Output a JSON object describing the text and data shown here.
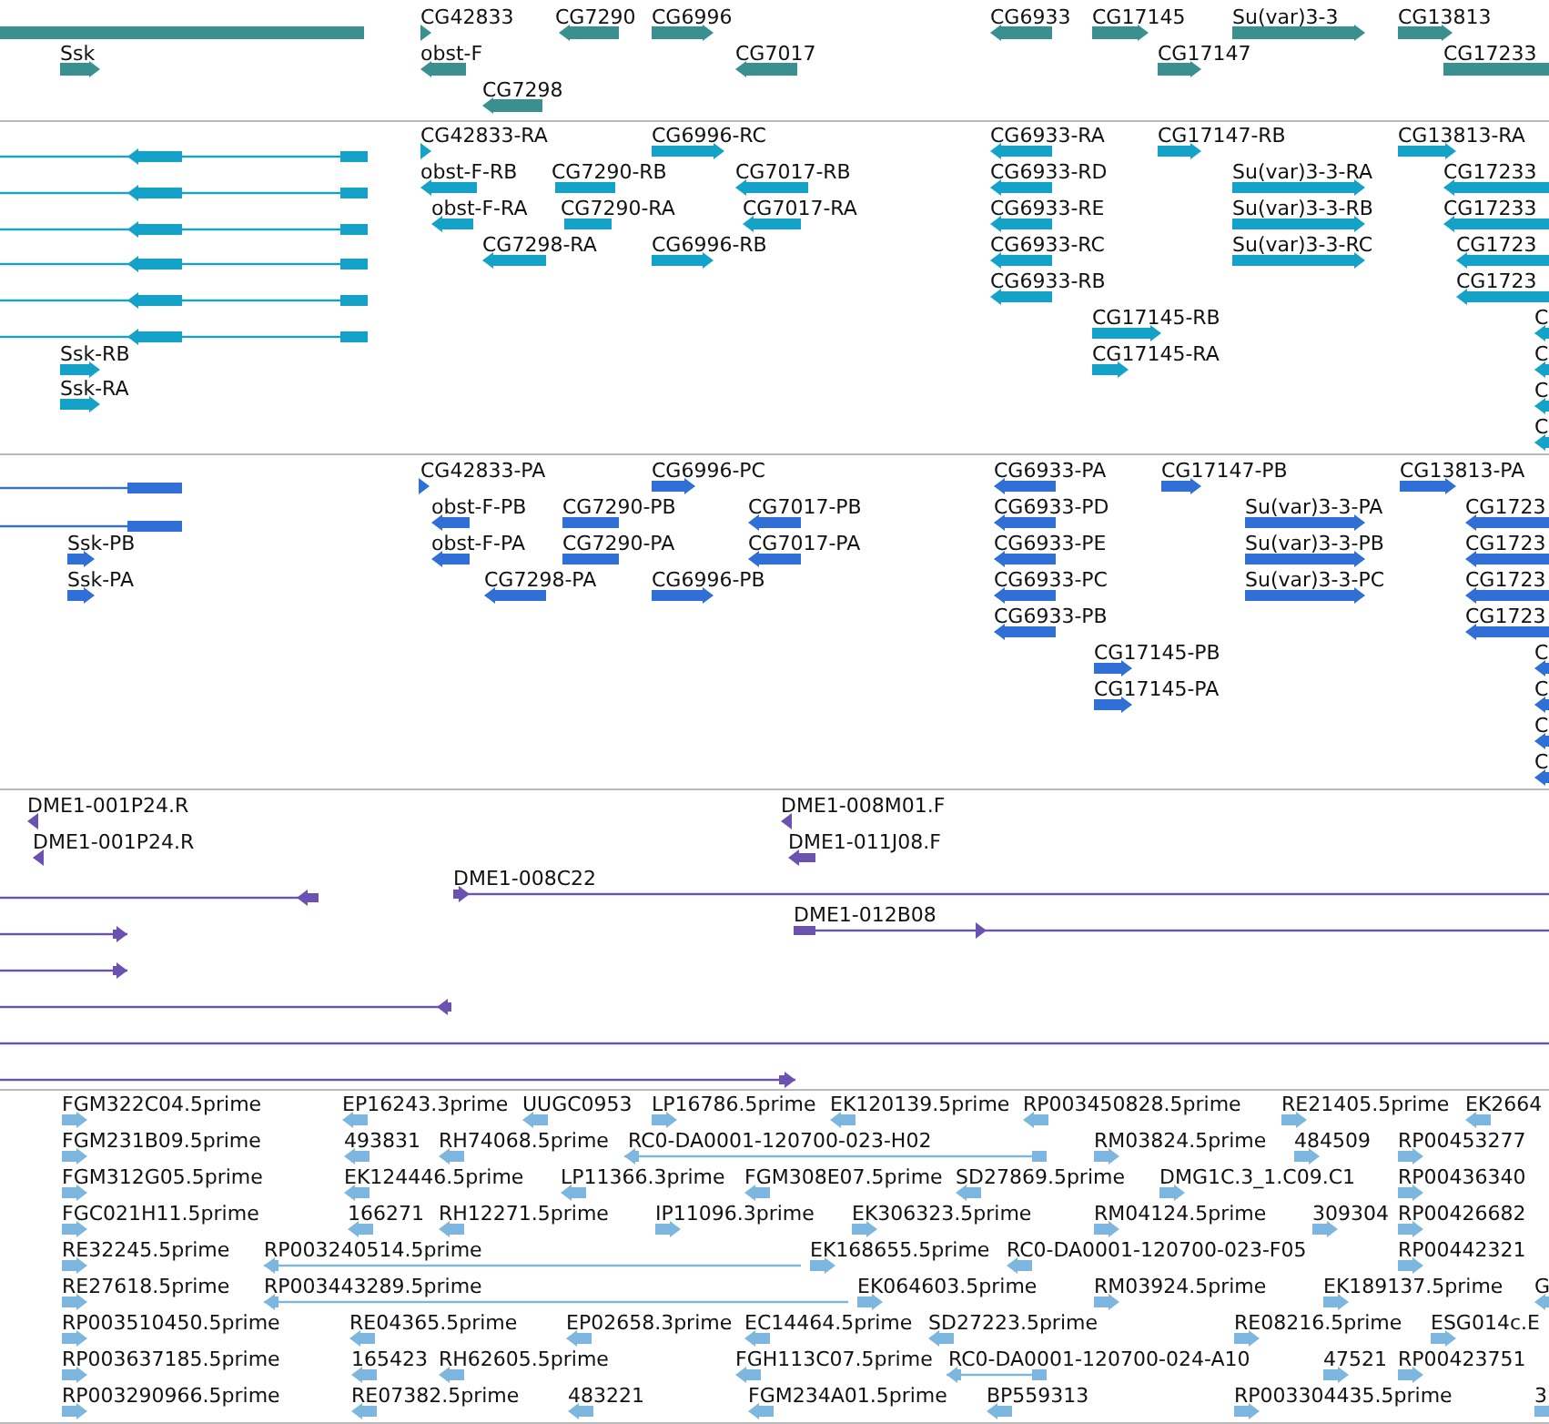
{
  "tracks": [
    {
      "kind": "gene",
      "color": "#3a8f91",
      "features": [
        {
          "clipped": true
        },
        {
          "label": "Ssk",
          "reverse": false
        },
        {
          "label": "CG42833",
          "reverse": false
        },
        {
          "label": "CG7290",
          "reverse": true
        },
        {
          "label": "CG6996",
          "reverse": false
        },
        {
          "label": "obst-F",
          "reverse": true
        },
        {
          "label": "CG7017",
          "reverse": true
        },
        {
          "label": "CG7298",
          "reverse": true
        },
        {
          "label": "CG6933",
          "reverse": true
        },
        {
          "label": "CG17145",
          "reverse": false
        },
        {
          "label": "Su(var)3-3",
          "reverse": false
        },
        {
          "label": "CG13813",
          "reverse": false
        },
        {
          "label": "CG17147",
          "reverse": false
        },
        {
          "label": "CG17233"
        }
      ]
    },
    {
      "kind": "transcript",
      "color": "#15a2c9",
      "features": [
        {
          "reverse": true
        },
        {
          "reverse": true
        },
        {
          "reverse": true
        },
        {
          "reverse": true
        },
        {
          "reverse": true
        },
        {
          "reverse": true
        },
        {
          "label": "Ssk-RB",
          "reverse": false
        },
        {
          "label": "Ssk-RA",
          "reverse": false
        },
        {
          "label": "CG42833-RA",
          "reverse": false
        },
        {
          "label": "CG6996-RC",
          "reverse": false
        },
        {
          "label": "obst-F-RB",
          "reverse": true
        },
        {
          "label": "CG7290-RB"
        },
        {
          "label": "CG7017-RB",
          "reverse": true
        },
        {
          "label": "obst-F-RA",
          "reverse": true
        },
        {
          "label": "CG7290-RA"
        },
        {
          "label": "CG7017-RA",
          "reverse": true
        },
        {
          "label": "CG7298-RA",
          "reverse": true
        },
        {
          "label": "CG6996-RB",
          "reverse": false
        },
        {
          "label": "CG6933-RA",
          "reverse": true
        },
        {
          "label": "CG6933-RD",
          "reverse": true
        },
        {
          "label": "CG6933-RE",
          "reverse": true
        },
        {
          "label": "CG6933-RC",
          "reverse": true
        },
        {
          "label": "CG6933-RB",
          "reverse": true
        },
        {
          "label": "CG17147-RB",
          "reverse": false
        },
        {
          "label": "CG13813-RA",
          "reverse": false
        },
        {
          "label": "Su(var)3-3-RA",
          "reverse": false
        },
        {
          "label": "Su(var)3-3-RB",
          "reverse": false
        },
        {
          "label": "Su(var)3-3-RC",
          "reverse": false
        },
        {
          "label": "CG17233",
          "reverse": true
        },
        {
          "label": "CG17233",
          "reverse": true
        },
        {
          "label": "CG1723",
          "reverse": true
        },
        {
          "label": "CG1723",
          "reverse": true
        },
        {
          "label": "C",
          "reverse": true
        },
        {
          "label": "C",
          "reverse": true
        },
        {
          "label": "C",
          "reverse": true
        },
        {
          "label": "C",
          "reverse": true
        },
        {
          "label": "CG17145-RB",
          "reverse": false
        },
        {
          "label": "CG17145-RA",
          "reverse": false
        }
      ]
    },
    {
      "kind": "protein",
      "color": "#2f6fd6",
      "features": [
        {
          "clipped": true
        },
        {
          "clipped": true
        },
        {
          "label": "Ssk-PB",
          "reverse": false
        },
        {
          "label": "Ssk-PA",
          "reverse": false
        },
        {
          "label": "CG42833-PA",
          "reverse": false
        },
        {
          "label": "CG6996-PC",
          "reverse": false
        },
        {
          "label": "obst-F-PB",
          "reverse": true
        },
        {
          "label": "CG7290-PB"
        },
        {
          "label": "CG7017-PB",
          "reverse": true
        },
        {
          "label": "obst-F-PA",
          "reverse": true
        },
        {
          "label": "CG7290-PA"
        },
        {
          "label": "CG7017-PA",
          "reverse": true
        },
        {
          "label": "CG7298-PA",
          "reverse": true
        },
        {
          "label": "CG6996-PB",
          "reverse": false
        },
        {
          "label": "CG6933-PA",
          "reverse": true
        },
        {
          "label": "CG6933-PD",
          "reverse": true
        },
        {
          "label": "CG6933-PE",
          "reverse": true
        },
        {
          "label": "CG6933-PC",
          "reverse": true
        },
        {
          "label": "CG6933-PB",
          "reverse": true
        },
        {
          "label": "CG17147-PB",
          "reverse": false
        },
        {
          "label": "CG13813-PA",
          "reverse": false
        },
        {
          "label": "Su(var)3-3-PA",
          "reverse": false
        },
        {
          "label": "Su(var)3-3-PB",
          "reverse": false
        },
        {
          "label": "Su(var)3-3-PC",
          "reverse": false
        },
        {
          "label": "CG1723",
          "reverse": true
        },
        {
          "label": "CG1723",
          "reverse": true
        },
        {
          "label": "CG1723",
          "reverse": true
        },
        {
          "label": "CG1723",
          "reverse": true
        },
        {
          "label": "C",
          "reverse": true
        },
        {
          "label": "C",
          "reverse": true
        },
        {
          "label": "C",
          "reverse": true
        },
        {
          "label": "C",
          "reverse": true
        },
        {
          "label": "CG17145-PB",
          "reverse": false
        },
        {
          "label": "CG17145-PA",
          "reverse": false
        }
      ]
    },
    {
      "kind": "clone",
      "color": "#6b52b2",
      "features": [
        {
          "label": "DME1-001P24.R",
          "reverse": true
        },
        {
          "label": "DME1-001P24.R",
          "reverse": true
        },
        {
          "label": "DME1-008M01.F",
          "reverse": true
        },
        {
          "label": "DME1-011J08.F",
          "reverse": true
        },
        {
          "reverse": true
        },
        {
          "label": "DME1-008C22",
          "reverse": false
        },
        {
          "label": "DME1-012B08",
          "reverse": false
        },
        {
          "reverse": false
        },
        {
          "reverse": false
        },
        {
          "reverse": true
        },
        {
          "clipped": true
        },
        {
          "reverse": false
        }
      ]
    },
    {
      "kind": "est",
      "color": "#7db6df",
      "features": [
        {
          "label": "FGM322C04.5prime",
          "reverse": false
        },
        {
          "label": "EP16243.3prime",
          "reverse": true
        },
        {
          "label": "UUGC0953",
          "reverse": true
        },
        {
          "label": "LP16786.5prime",
          "reverse": false
        },
        {
          "label": "EK120139.5prime",
          "reverse": true
        },
        {
          "label": "RP003450828.5prime",
          "reverse": true
        },
        {
          "label": "RE21405.5prime",
          "reverse": false
        },
        {
          "label": "EK2664",
          "reverse": true
        },
        {
          "label": "FGM231B09.5prime",
          "reverse": false
        },
        {
          "label": "493831",
          "reverse": true
        },
        {
          "label": "RH74068.5prime",
          "reverse": true
        },
        {
          "label": "RC0-DA0001-120700-023-H02",
          "reverse": true
        },
        {
          "label": "RM03824.5prime",
          "reverse": false
        },
        {
          "label": "484509",
          "reverse": false
        },
        {
          "label": "RP00453277",
          "reverse": false
        },
        {
          "label": "FGM312G05.5prime",
          "reverse": false
        },
        {
          "label": "EK124446.5prime",
          "reverse": true
        },
        {
          "label": "LP11366.3prime",
          "reverse": true
        },
        {
          "label": "FGM308E07.5prime",
          "reverse": true
        },
        {
          "label": "SD27869.5prime",
          "reverse": true
        },
        {
          "label": "DMG1C.3_1.C09.C1",
          "reverse": false
        },
        {
          "label": "RP00436340",
          "reverse": false
        },
        {
          "label": "FGC021H11.5prime",
          "reverse": false
        },
        {
          "label": "166271",
          "reverse": true
        },
        {
          "label": "RH12271.5prime",
          "reverse": true
        },
        {
          "label": "IP11096.3prime",
          "reverse": false
        },
        {
          "label": "EK306323.5prime",
          "reverse": false
        },
        {
          "label": "RM04124.5prime",
          "reverse": false
        },
        {
          "label": "309304",
          "reverse": false
        },
        {
          "label": "RP00426682",
          "reverse": false
        },
        {
          "label": "RE32245.5prime",
          "reverse": false
        },
        {
          "label": "RP003240514.5prime",
          "reverse": true
        },
        {
          "label": "EK168655.5prime",
          "reverse": false
        },
        {
          "label": "RC0-DA0001-120700-023-F05",
          "reverse": true
        },
        {
          "label": "RP00442321",
          "reverse": false
        },
        {
          "label": "RE27618.5prime",
          "reverse": false
        },
        {
          "label": "RP003443289.5prime",
          "reverse": true
        },
        {
          "label": "EK064603.5prime",
          "reverse": false
        },
        {
          "label": "RM03924.5prime",
          "reverse": false
        },
        {
          "label": "EK189137.5prime",
          "reverse": false
        },
        {
          "label": "G",
          "reverse": true
        },
        {
          "label": "RP003510450.5prime",
          "reverse": false
        },
        {
          "label": "RE04365.5prime",
          "reverse": true
        },
        {
          "label": "EP02658.3prime",
          "reverse": true
        },
        {
          "label": "EC14464.5prime",
          "reverse": true
        },
        {
          "label": "SD27223.5prime",
          "reverse": true
        },
        {
          "label": "RE08216.5prime",
          "reverse": false
        },
        {
          "label": "ESG014c.E",
          "reverse": false
        },
        {
          "label": "RP003637185.5prime",
          "reverse": false
        },
        {
          "label": "165423",
          "reverse": true
        },
        {
          "label": "RH62605.5prime",
          "reverse": true
        },
        {
          "label": "FGH113C07.5prime",
          "reverse": true
        },
        {
          "label": "RC0-DA0001-120700-024-A10",
          "reverse": true
        },
        {
          "label": "47521",
          "reverse": false
        },
        {
          "label": "RP00423751",
          "reverse": false
        },
        {
          "label": "RP003290966.5prime",
          "reverse": false
        },
        {
          "label": "RE07382.5prime",
          "reverse": true
        },
        {
          "label": "483221",
          "reverse": true
        },
        {
          "label": "FGM234A01.5prime",
          "reverse": true
        },
        {
          "label": "BP559313",
          "reverse": true
        },
        {
          "label": "RP003304435.5prime",
          "reverse": false
        },
        {
          "label": "3",
          "reverse": false
        }
      ]
    }
  ]
}
